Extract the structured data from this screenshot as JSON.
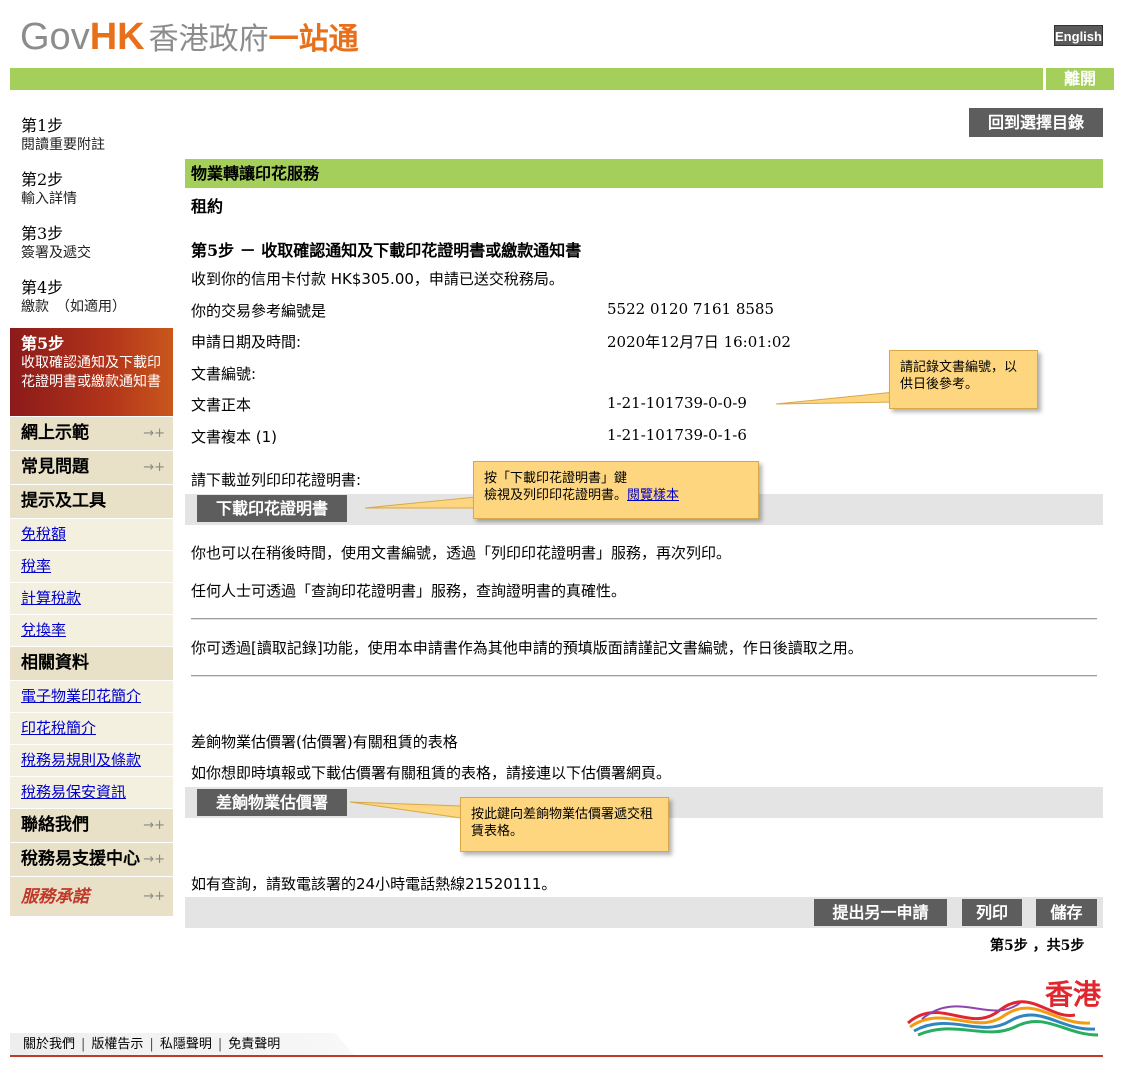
{
  "header": {
    "logo_gov": "Gov",
    "logo_hk": "HK",
    "logo_zh1": "香港政府",
    "logo_zh2": "一站通",
    "lang_button": "English",
    "leave_button": "離開"
  },
  "sidebar": {
    "steps": [
      {
        "title": "第1步",
        "desc": "閱讀重要附註"
      },
      {
        "title": "第2步",
        "desc": "輸入詳情"
      },
      {
        "title": "第3步",
        "desc": "簽署及遞交"
      },
      {
        "title": "第4步",
        "desc": "繳款　（如適用）"
      },
      {
        "title": "第5步",
        "desc": "收取確認通知及下載印花證明書或繳款通知書"
      }
    ],
    "menu": [
      {
        "type": "header",
        "label": "網上示範",
        "arrow": true
      },
      {
        "type": "header",
        "label": "常見問題",
        "arrow": true
      },
      {
        "type": "header",
        "label": "提示及工具",
        "arrow": false
      },
      {
        "type": "item",
        "label": "免稅額"
      },
      {
        "type": "item",
        "label": "稅率"
      },
      {
        "type": "item",
        "label": "計算稅款"
      },
      {
        "type": "item",
        "label": "兌換率"
      },
      {
        "type": "header",
        "label": "相關資料",
        "arrow": false
      },
      {
        "type": "item",
        "label": "電子物業印花簡介"
      },
      {
        "type": "item",
        "label": "印花稅簡介"
      },
      {
        "type": "item",
        "label": "稅務易規則及條款"
      },
      {
        "type": "item",
        "label": "稅務易保安資訊"
      },
      {
        "type": "header",
        "label": "聯絡我們",
        "arrow": true
      },
      {
        "type": "header",
        "label": "稅務易支援中心",
        "arrow": true
      },
      {
        "type": "logo",
        "label": "服務承諾",
        "arrow": true
      }
    ]
  },
  "main": {
    "back_button": "回到選擇目錄",
    "service_title": "物業轉讓印花服務",
    "subtitle": "租約",
    "step_title": "第5步 － 收取確認通知及下載印花證明書或繳款通知書",
    "payment_msg": "收到你的信用卡付款 HK$305.00，申請已送交稅務局。",
    "fields": [
      {
        "label": "你的交易參考編號是",
        "value": "5522 0120 7161 8585"
      },
      {
        "label": "申請日期及時間:",
        "value": "2020年12月7日 16:01:02"
      },
      {
        "label": "文書編號:",
        "value": ""
      },
      {
        "label": "文書正本",
        "value": "1-21-101739-0-0-9"
      },
      {
        "label": "文書複本 (1)",
        "value": "1-21-101739-0-1-6"
      }
    ],
    "download_prompt": "請下載並列印印花證明書:",
    "download_button": "下載印花證明書",
    "reprint_msg": "你也可以在稍後時間，使用文書編號，透過「列印印花證明書」服務，再次列印。",
    "verify_msg": "任何人士可透過「查詢印花證明書」服務，查詢證明書的真確性。",
    "retrieve_msg": "你可透過[讀取記錄]功能，使用本申請書作為其他申請的預填版面請謹記文書編號，作日後讀取之用。",
    "rvd_title": "差餉物業估價署(估價署)有關租賃的表格",
    "rvd_msg": "如你想即時填報或下載估價署有關租賃的表格，請接連以下估價署網頁。",
    "rvd_button": "差餉物業估價署",
    "enquiry_msg": "如有查詢，請致電該署的24小時電話熱線21520111。",
    "actions": {
      "another": "提出另一申請",
      "print": "列印",
      "save": "儲存"
    },
    "step_count": "第5步 ，共5步"
  },
  "callouts": {
    "record": "請記錄文書編號，以供日後參考。",
    "download_line1": "按「下載印花證明書」鍵",
    "download_line2": "檢視及列印印花證明書。",
    "download_link": "閱覽樣本",
    "rvd": "按此鍵向差餉物業估價署遞交租賃表格。"
  },
  "footer": {
    "links": [
      "關於我們",
      "版權告示",
      "私隱聲明",
      "免責聲明"
    ],
    "brand": "香港"
  },
  "colors": {
    "green": "#a4cf5a",
    "orange": "#e8701a",
    "active_step": "#b2341a",
    "button_gray": "#5d5d5d",
    "callout": "#fdd67f"
  }
}
